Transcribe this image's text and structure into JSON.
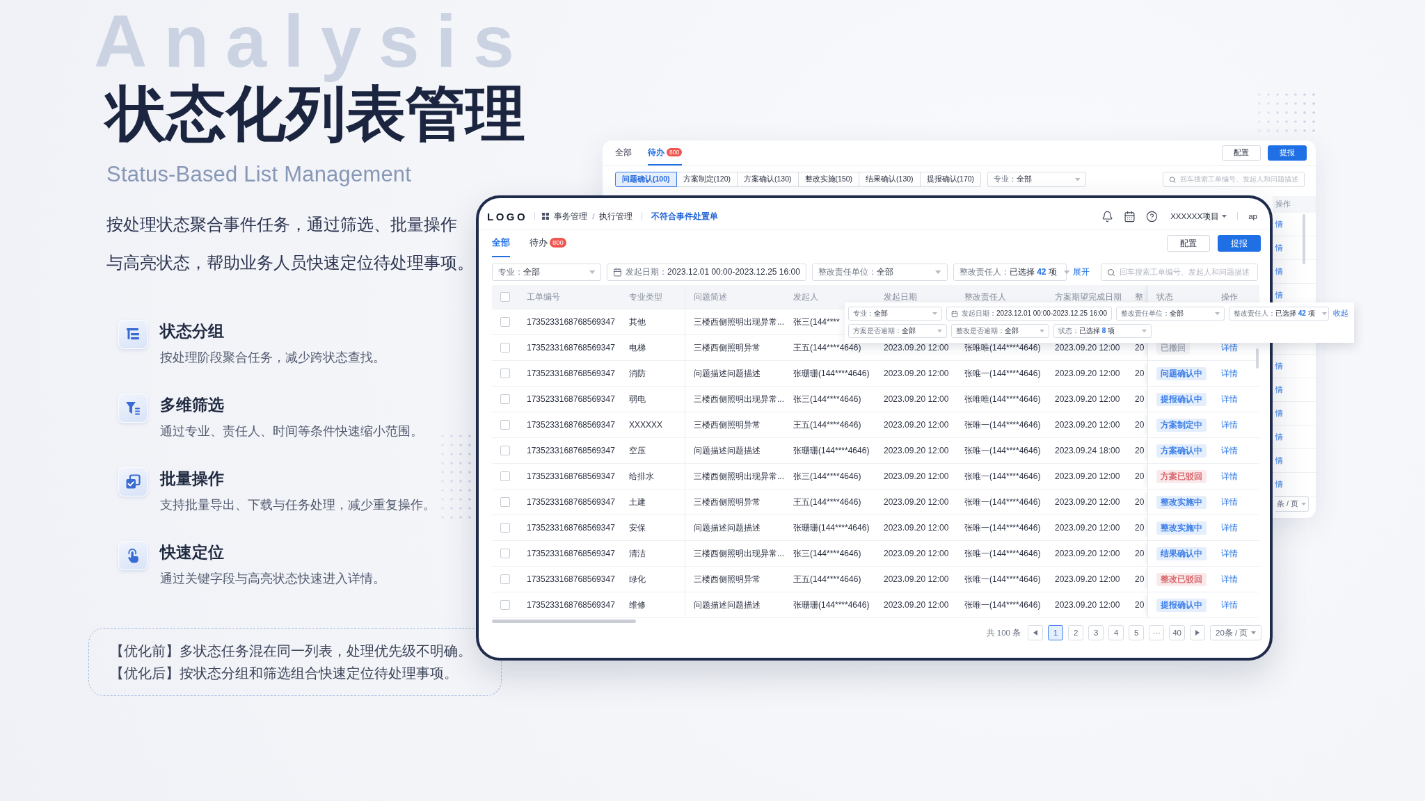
{
  "backdrop_word": "Analysis",
  "hero": {
    "title": "状态化列表管理",
    "subtitle": "Status-Based List Management",
    "intro_lines": [
      "按处理状态聚合事件任务，通过筛选、批量操作",
      "与高亮状态，帮助业务人员快速定位待处理事项。"
    ]
  },
  "features": [
    {
      "title": "状态分组",
      "text": "按处理阶段聚合任务，减少跨状态查找。"
    },
    {
      "title": "多维筛选",
      "text": "通过专业、责任人、时间等条件快速缩小范围。"
    },
    {
      "title": "批量操作",
      "text": "支持批量导出、下载与任务处理，减少重复操作。"
    },
    {
      "title": "快速定位",
      "text": "通过关键字段与高亮状态快速进入详情。"
    }
  ],
  "comparison": [
    "【优化前】多状态任务混在同一列表，处理优先级不明确。",
    "【优化后】按状态分组和筛选组合快速定位待处理事项。"
  ],
  "back_window": {
    "tabs": [
      {
        "label": "全部",
        "selected": false
      },
      {
        "label": "待办",
        "badge": "800",
        "selected": true
      }
    ],
    "buttons": [
      {
        "label": "配置",
        "kind": "default"
      },
      {
        "label": "提报",
        "kind": "primary"
      }
    ],
    "stage_tabs": [
      {
        "label": "问题确认(100)",
        "selected": true
      },
      {
        "label": "方案制定(120)",
        "selected": false
      },
      {
        "label": "方案确认(130)",
        "selected": false
      },
      {
        "label": "整改实施(150)",
        "selected": false
      },
      {
        "label": "结果确认(130)",
        "selected": false
      },
      {
        "label": "提报确认(170)",
        "selected": false
      }
    ],
    "filter": {
      "label": "专业：",
      "value": "全部"
    },
    "search": {
      "placeholder": "回车搜索工单编号、发起人和问题描述"
    },
    "column_header": "操作",
    "row_links": [
      "情",
      "情",
      "情",
      "情",
      "情",
      "情",
      "情",
      "情",
      "情",
      "情"
    ],
    "page_size": "条 / 页"
  },
  "front_window": {
    "logo": "LOGO",
    "breadcrumb": {
      "items": [
        "事务管理",
        "执行管理"
      ],
      "separator": "/"
    },
    "page_title": "不符合事件处置单",
    "project": "XXXXXX项目",
    "user": "ap",
    "tabs": [
      {
        "label": "全部",
        "selected": true
      },
      {
        "label": "待办",
        "badge": "800",
        "selected": false
      }
    ],
    "buttons": [
      {
        "label": "配置",
        "kind": "default"
      },
      {
        "label": "提报",
        "kind": "primary"
      }
    ],
    "filters": [
      {
        "kind": "select",
        "label": "专业：",
        "value": "全部"
      },
      {
        "kind": "date",
        "label": "发起日期：",
        "value": "2023.12.01 00:00-2023.12.25 16:00"
      },
      {
        "kind": "select",
        "label": "整改责任单位：",
        "value": "全部"
      },
      {
        "kind": "select",
        "label": "整改责任人：",
        "value": "已选择 **42** 项"
      }
    ],
    "expand_link": "展开",
    "search": {
      "placeholder": "回车搜索工单编号、发起人和问题描述"
    },
    "table": {
      "header_checked": false,
      "columns": [
        "工单编号",
        "专业类型",
        "问题简述",
        "发起人",
        "发起日期",
        "整改责任人",
        "方案期望完成日期",
        "整",
        "状态",
        "操作"
      ],
      "rows": [
        {
          "checked": false,
          "id": "1735233168768569347",
          "category": "其他",
          "summary": "三楼西侧照明出现异常...",
          "initiator": "张三(144****"
        },
        {
          "checked": false,
          "id": "1735233168768569347",
          "category": "电梯",
          "summary": "三楼西侧照明异常",
          "initiator": "王五(144****4646)",
          "start_date": "2023.09.20 12:00",
          "assignee": "张唯唯(144****4646)",
          "due_date": "2023.09.20 12:00",
          "column_9": "20",
          "status": {
            "label": "已撤回",
            "color": "#a9aeb8"
          },
          "action": "详情"
        },
        {
          "checked": false,
          "id": "1735233168768569347",
          "category": "消防",
          "summary": "问题描述问题描述",
          "initiator": "张珊珊(144****4646)",
          "start_date": "2023.09.20 12:00",
          "assignee": "张唯一(144****4646)",
          "due_date": "2023.09.20 12:00",
          "column_9": "20",
          "status": {
            "label": "问题确认中",
            "color": "#3a7ee8"
          },
          "action": "详情"
        },
        {
          "checked": false,
          "id": "1735233168768569347",
          "category": "弱电",
          "summary": "三楼西侧照明出现异常...",
          "initiator": "张三(144****4646)",
          "start_date": "2023.09.20 12:00",
          "assignee": "张唯唯(144****4646)",
          "due_date": "2023.09.20 12:00",
          "column_9": "20",
          "status": {
            "label": "提报确认中",
            "color": "#3a7ee8"
          },
          "action": "详情"
        },
        {
          "checked": false,
          "id": "1735233168768569347",
          "category": "XXXXXX",
          "summary": "三楼西侧照明异常",
          "initiator": "王五(144****4646)",
          "start_date": "2023.09.20 12:00",
          "assignee": "张唯一(144****4646)",
          "due_date": "2023.09.20 12:00",
          "column_9": "20",
          "status": {
            "label": "方案制定中",
            "color": "#3a7ee8"
          },
          "action": "详情"
        },
        {
          "checked": false,
          "id": "1735233168768569347",
          "category": "空压",
          "summary": "问题描述问题描述",
          "initiator": "张珊珊(144****4646)",
          "start_date": "2023.09.20 12:00",
          "assignee": "张唯一(144****4646)",
          "due_date": "2023.09.24 18:00",
          "column_9": "20",
          "status": {
            "label": "方案确认中",
            "color": "#3a7ee8"
          },
          "action": "详情"
        },
        {
          "checked": false,
          "id": "1735233168768569347",
          "category": "给排水",
          "summary": "三楼西侧照明出现异常...",
          "initiator": "张三(144****4646)",
          "start_date": "2023.09.20 12:00",
          "assignee": "张唯一(144****4646)",
          "due_date": "2023.09.20 12:00",
          "column_9": "20",
          "status": {
            "label": "方案已驳回",
            "color": "#d8656a"
          },
          "action": "详情"
        },
        {
          "checked": false,
          "id": "1735233168768569347",
          "category": "土建",
          "summary": "三楼西侧照明异常",
          "initiator": "王五(144****4646)",
          "start_date": "2023.09.20 12:00",
          "assignee": "张唯一(144****4646)",
          "due_date": "2023.09.20 12:00",
          "column_9": "20",
          "status": {
            "label": "整改实施中",
            "color": "#3a7ee8"
          },
          "action": "详情"
        },
        {
          "checked": false,
          "id": "1735233168768569347",
          "category": "安保",
          "summary": "问题描述问题描述",
          "initiator": "张珊珊(144****4646)",
          "start_date": "2023.09.20 12:00",
          "assignee": "张唯一(144****4646)",
          "due_date": "2023.09.20 12:00",
          "column_9": "20",
          "status": {
            "label": "整改实施中",
            "color": "#3a7ee8"
          },
          "action": "详情"
        },
        {
          "checked": false,
          "id": "1735233168768569347",
          "category": "清洁",
          "summary": "三楼西侧照明出现异常...",
          "initiator": "张三(144****4646)",
          "start_date": "2023.09.20 12:00",
          "assignee": "张唯一(144****4646)",
          "due_date": "2023.09.20 12:00",
          "column_9": "20",
          "status": {
            "label": "结果确认中",
            "color": "#3a7ee8"
          },
          "action": "详情"
        },
        {
          "checked": false,
          "id": "1735233168768569347",
          "category": "绿化",
          "summary": "三楼西侧照明异常",
          "initiator": "王五(144****4646)",
          "start_date": "2023.09.20 12:00",
          "assignee": "张唯一(144****4646)",
          "due_date": "2023.09.20 12:00",
          "column_9": "20",
          "status": {
            "label": "整改已驳回",
            "color": "#d8656a"
          },
          "action": "详情"
        },
        {
          "checked": false,
          "id": "1735233168768569347",
          "category": "维修",
          "summary": "问题描述问题描述",
          "initiator": "张珊珊(144****4646)",
          "start_date": "2023.09.20 12:00",
          "assignee": "张唯一(144****4646)",
          "due_date": "2023.09.20 12:00",
          "column_9": "20",
          "status": {
            "label": "提报确认中",
            "color": "#3a7ee8"
          },
          "action": "详情"
        }
      ]
    },
    "pagination": {
      "total": "共 100 条",
      "pages": [
        {
          "label": "1",
          "selected": true
        },
        {
          "label": "2",
          "selected": false
        },
        {
          "label": "3",
          "selected": false
        },
        {
          "label": "4",
          "selected": false
        },
        {
          "label": "5",
          "selected": false
        },
        {
          "label": "···",
          "selected": false
        },
        {
          "label": "40",
          "selected": false
        }
      ],
      "page_size": "20条 / 页"
    }
  },
  "filter_popup": {
    "fields": [
      {
        "kind": "select",
        "label": "专业：",
        "value": "全部"
      },
      {
        "kind": "date",
        "label": "发起日期：",
        "value": "2023.12.01 00:00-2023.12.25 16:00"
      },
      {
        "kind": "select",
        "label": "整改责任单位：",
        "value": "全部"
      },
      {
        "kind": "select",
        "label": "整改责任人：",
        "value": "已选择 **42** 项"
      },
      {
        "kind": "select",
        "label": "方案是否逾期：",
        "value": "全部"
      },
      {
        "kind": "select",
        "label": "整改是否逾期：",
        "value": "全部"
      },
      {
        "kind": "select",
        "label": "状态：",
        "value": "已选择 **8** 项"
      }
    ],
    "collapse_link": "收起"
  }
}
